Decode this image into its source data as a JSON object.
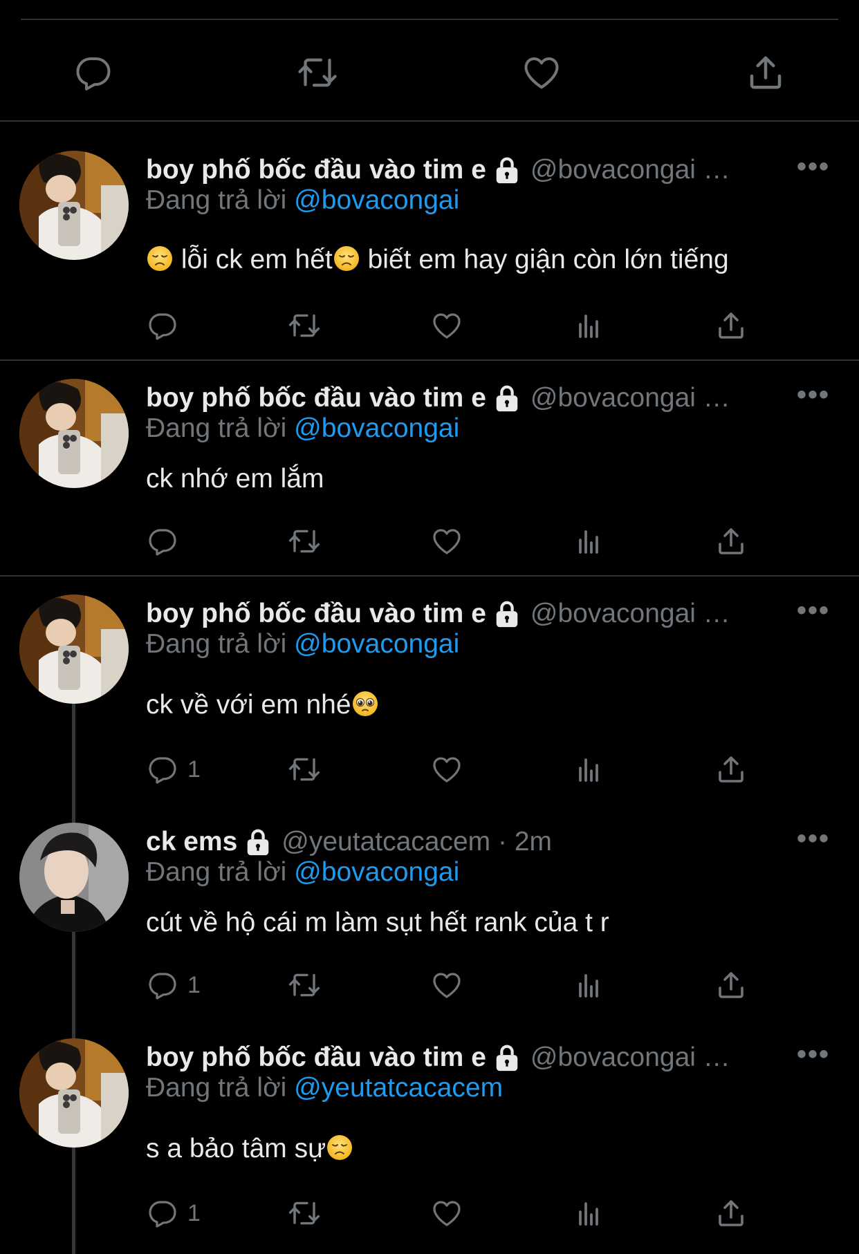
{
  "colors": {
    "background": "#000000",
    "text": "#e7e9ea",
    "secondary": "#71767b",
    "link": "#1d9bf0",
    "divider": "#2f3336"
  },
  "icons": [
    "reply-icon",
    "retweet-icon",
    "like-icon",
    "analytics-icon",
    "share-icon",
    "lock-icon",
    "more-icon",
    "disappointed-emoji",
    "pleading-emoji"
  ],
  "reply_prefix": "Đang trả lời",
  "tweets": [
    {
      "name": "boy phố bốc đầu vào tim e",
      "handle": "@bovacongai …",
      "reply_to": "@bovacongai",
      "text_pre": "",
      "text_a": "lỗi ck em hết",
      "text_b": " biết em hay giận còn lớn tiếng",
      "more": "•••",
      "reply_count": ""
    },
    {
      "name": "boy phố bốc đầu vào tim e",
      "handle": "@bovacongai …",
      "reply_to": "@bovacongai",
      "text": "ck nhớ em lắm",
      "more": "•••",
      "reply_count": ""
    },
    {
      "name": "boy phố bốc đầu vào tim e",
      "handle": "@bovacongai …",
      "reply_to": "@bovacongai",
      "text": "ck về với em nhé",
      "more": "•••",
      "reply_count": "1"
    },
    {
      "name": "ck ems",
      "handle": "@yeutatcacacem · 2m",
      "reply_to": "@bovacongai",
      "text": "cút về hộ cái m làm sụt hết rank của t r",
      "more": "•••",
      "reply_count": "1"
    },
    {
      "name": "boy phố bốc đầu vào tim e",
      "handle": "@bovacongai …",
      "reply_to": "@yeutatcacacem",
      "text": "s a bảo tâm sự",
      "more": "•••",
      "reply_count": "1"
    }
  ]
}
